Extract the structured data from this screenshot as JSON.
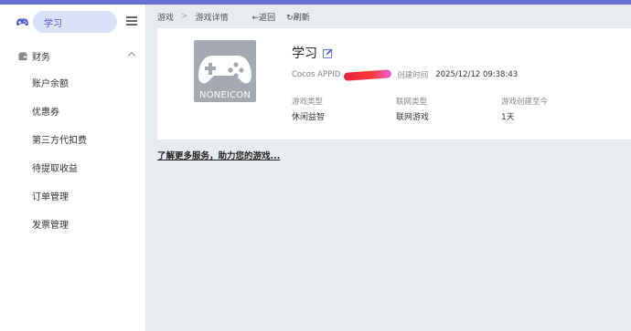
{
  "app_switcher": {
    "label": "学习"
  },
  "sidebar": {
    "section_label": "财务",
    "items": [
      {
        "label": "账户余额"
      },
      {
        "label": "优惠券"
      },
      {
        "label": "第三方代扣费"
      },
      {
        "label": "待提取收益"
      },
      {
        "label": "订单管理"
      },
      {
        "label": "发票管理"
      }
    ]
  },
  "breadcrumb": {
    "root": "游戏",
    "separator": ">",
    "current": "游戏详情"
  },
  "actions": {
    "back_label": "返回",
    "refresh_label": "刷新"
  },
  "game": {
    "thumbnail_text": "NONEICON",
    "name": "学习",
    "appid_label": "Cocos APPID",
    "created_label": "创建时间",
    "created_value": "2025/12/12 09:38:43",
    "stats": [
      {
        "label": "游戏类型",
        "value": "休闲益智"
      },
      {
        "label": "联网类型",
        "value": "联网游戏"
      },
      {
        "label": "游戏创建至今",
        "value": "1天"
      }
    ]
  },
  "more_link": "了解更多服务，助力您的游戏..."
}
